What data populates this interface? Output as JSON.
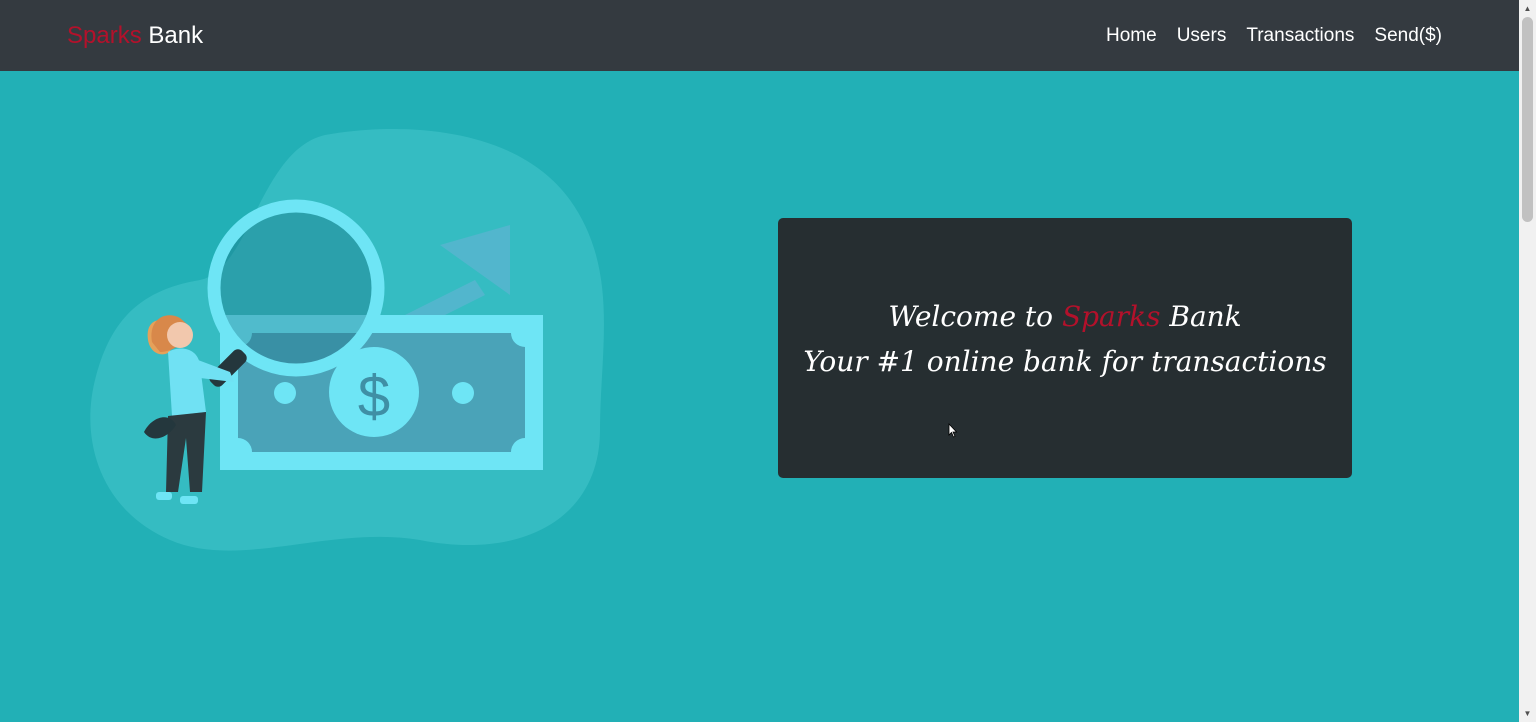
{
  "navbar": {
    "brand": {
      "accent": "Sparks",
      "rest": "Bank"
    },
    "links": [
      "Home",
      "Users",
      "Transactions",
      "Send($)"
    ]
  },
  "hero": {
    "welcome_prefix": "Welcome to",
    "welcome_accent": "Sparks",
    "welcome_suffix": "Bank",
    "tagline": "Your #1 online bank for transactions"
  },
  "illustration": {
    "name": "money-search-illustration",
    "symbol": "$"
  },
  "colors": {
    "navbar_bg": "#343a40",
    "page_bg": "#22b0b6",
    "card_bg": "#262e31",
    "accent": "#b3112b"
  }
}
